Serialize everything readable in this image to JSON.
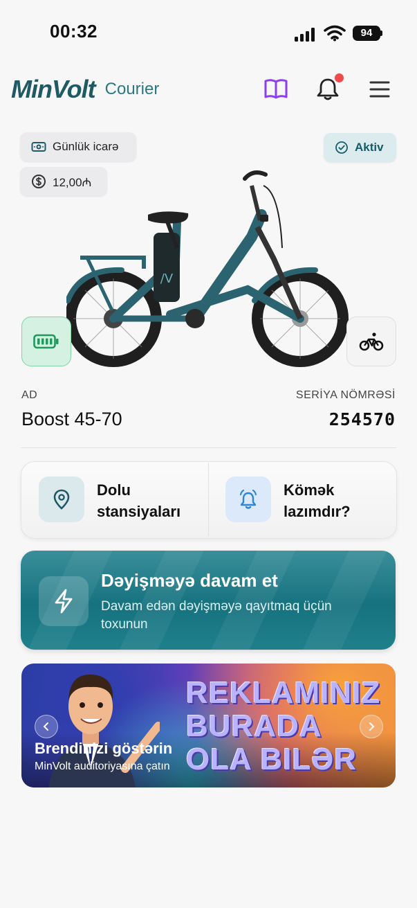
{
  "status_bar": {
    "time": "00:32",
    "battery": "94"
  },
  "header": {
    "logo": "MinVolt",
    "logo_suffix": "Courier"
  },
  "pills": {
    "rental_type": "Günlük icarə",
    "price": "12,00₼",
    "status": "Aktiv"
  },
  "vehicle": {
    "name_label": "AD",
    "name": "Boost 45-70",
    "serial_label": "SERİYA NÖMRƏSİ",
    "serial": "254570"
  },
  "quick_actions": {
    "stations_line1": "Dolu",
    "stations_line2": "stansiyaları",
    "help_line1": "Kömək",
    "help_line2": "lazımdır?"
  },
  "swap": {
    "title": "Dəyişməyə davam et",
    "subtitle": "Davam edən dəyişməyə qayıtmaq üçün toxunun"
  },
  "ad": {
    "line1": "REKLAMINIZ",
    "line2": "BURADA",
    "line3": "OLA BILƏR",
    "title": "Brendinizi göstərin",
    "subtitle": "MinVolt auditoriyasına çatın"
  },
  "colors": {
    "brand_teal": "#1e5964",
    "accent_purple": "#8a3ff0",
    "success_green": "#2bb673",
    "notification_red": "#ef4b4b"
  }
}
